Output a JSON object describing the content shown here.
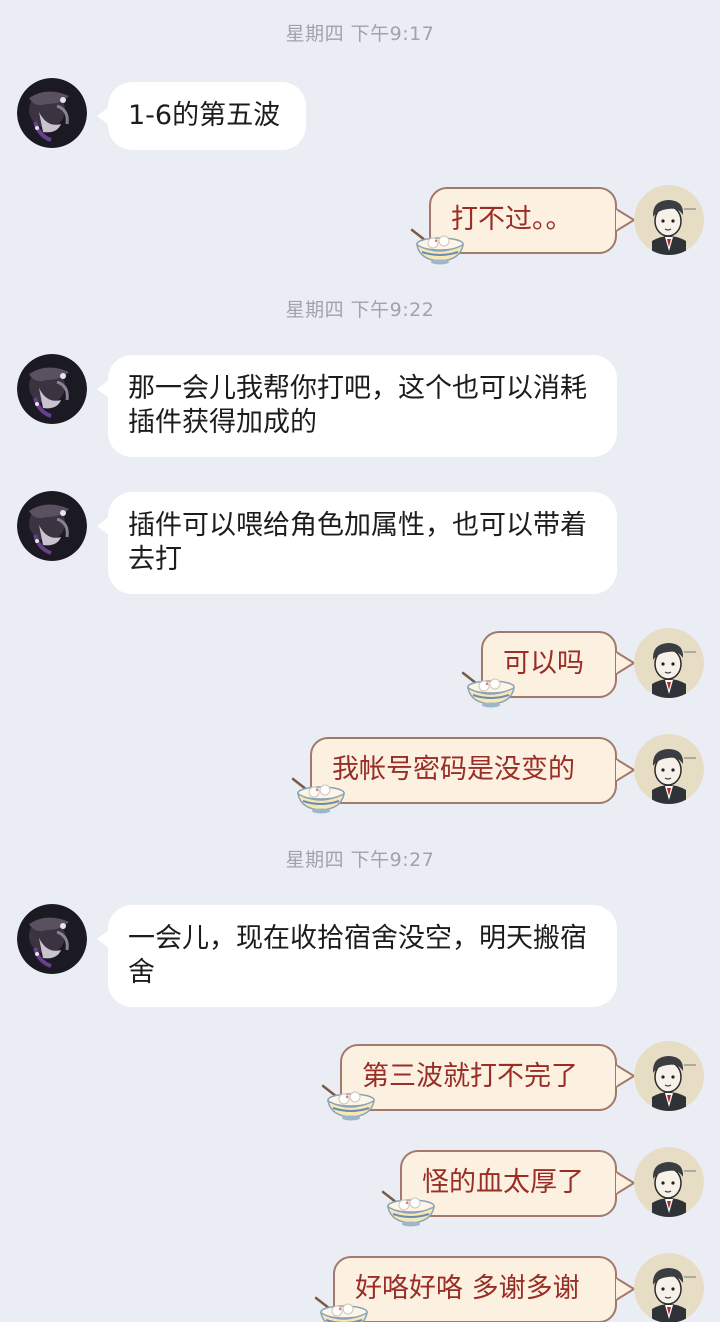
{
  "timestamps": [
    "星期四 下午9:17",
    "星期四 下午9:22",
    "星期四 下午9:27"
  ],
  "messages": [
    {
      "from": "other",
      "text": "1-6的第五波"
    },
    {
      "from": "me",
      "text": "打不过。。"
    },
    {
      "from": "other",
      "text": "那一会儿我帮你打吧，这个也可以消耗插件获得加成的"
    },
    {
      "from": "other",
      "text": "插件可以喂给角色加属性，也可以带着去打"
    },
    {
      "from": "me",
      "text": "可以吗"
    },
    {
      "from": "me",
      "text": "我帐号密码是没变的"
    },
    {
      "from": "other",
      "text": "一会儿，现在收拾宿舍没空，明天搬宿舍"
    },
    {
      "from": "me",
      "text": "第三波就打不完了"
    },
    {
      "from": "me",
      "text": "怪的血太厚了"
    },
    {
      "from": "me",
      "text": "好咯好咯 多谢多谢"
    }
  ],
  "colors": {
    "background": "#ebedf5",
    "incoming_bubble": "#ffffff",
    "outgoing_bubble": "#fcf1e0",
    "outgoing_border": "#a2796c",
    "outgoing_text": "#9a2d25"
  },
  "icons": {
    "other_avatar": "dark-anime-avatar",
    "my_avatar": "cartoon-man-avatar",
    "bubble_decoration": "rice-bowl-icon"
  }
}
